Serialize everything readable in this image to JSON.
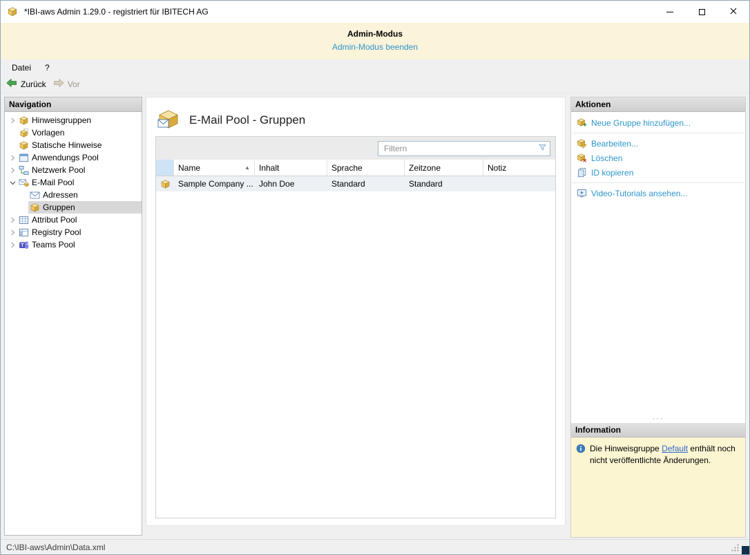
{
  "colors": {
    "banner_bg": "#fbf3da",
    "accent_link": "#2e96cc",
    "info_bg": "#fbf5d2",
    "row_bg": "#edf1f5",
    "icon_header_cell_bg": "#cfe3f6",
    "selected_tree_bg": "#d8d8d8"
  },
  "icons": {
    "sort_ascending": "▲",
    "splitter_dots": "···"
  },
  "window": {
    "title": "*IBI-aws Admin 1.29.0 - registriert für IBITECH AG"
  },
  "banner": {
    "title": "Admin-Modus",
    "link_label": "Admin-Modus beenden"
  },
  "menubar": {
    "items": [
      {
        "label": "Datei"
      },
      {
        "label": "?"
      }
    ]
  },
  "toolbar": {
    "back_label": "Zurück",
    "forward_label": "Vor"
  },
  "navigation": {
    "header": "Navigation",
    "items": [
      {
        "label": "Hinweisgruppen"
      },
      {
        "label": "Vorlagen"
      },
      {
        "label": "Statische Hinweise"
      },
      {
        "label": "Anwendungs Pool"
      },
      {
        "label": "Netzwerk Pool"
      },
      {
        "label": "E-Mail Pool"
      },
      {
        "label": "Adressen"
      },
      {
        "label": "Gruppen"
      },
      {
        "label": "Attribut Pool"
      },
      {
        "label": "Registry Pool"
      },
      {
        "label": "Teams Pool"
      }
    ]
  },
  "content": {
    "title": "E-Mail Pool - Gruppen",
    "filter_placeholder": "Filtern",
    "table": {
      "columns": [
        "Name",
        "Inhalt",
        "Sprache",
        "Zeitzone",
        "Notiz"
      ],
      "rows": [
        {
          "name": "Sample Company ...",
          "inhalt": "John Doe",
          "sprache": "Standard",
          "zeitzone": "Standard",
          "notiz": ""
        }
      ]
    }
  },
  "actions": {
    "header": "Aktionen",
    "items": [
      {
        "label": "Neue Gruppe hinzufügen..."
      },
      {
        "label": "Bearbeiten..."
      },
      {
        "label": "Löschen"
      },
      {
        "label": "ID kopieren"
      },
      {
        "label": "Video-Tutorials ansehen..."
      }
    ]
  },
  "information": {
    "header": "Information",
    "text_before": "Die Hinweisgruppe ",
    "link_label": "Default",
    "text_after": " enthält noch nicht veröffentlichte Änderungen."
  },
  "statusbar": {
    "path": "C:\\IBI-aws\\Admin\\Data.xml"
  }
}
